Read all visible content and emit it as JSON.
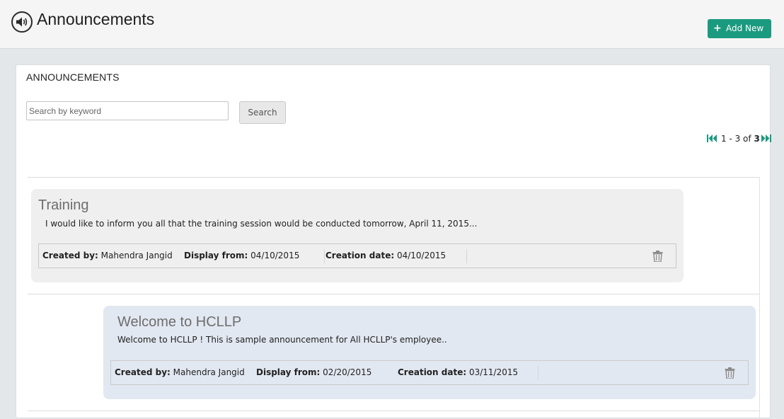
{
  "header": {
    "title": "Announcements",
    "add_button_label": "Add New"
  },
  "panel": {
    "title": "ANNOUNCEMENTS",
    "search": {
      "placeholder": "Search by keyword",
      "value": "",
      "button_label": "Search"
    },
    "pagination": {
      "range": "1 - 3 of",
      "total": "3"
    }
  },
  "announcements": [
    {
      "title": "Training",
      "body": "I would like to inform you all that the training session would be conducted tomorrow, April 11, 2015...",
      "created_by_label": "Created by:",
      "created_by": "Mahendra Jangid",
      "display_from_label": "Display from:",
      "display_from": "04/10/2015",
      "creation_date_label": "Creation date:",
      "creation_date": "04/10/2015"
    },
    {
      "title": "Welcome to HCLLP",
      "body": "Welcome to HCLLP ! This is sample announcement for All HCLLP's employee..",
      "created_by_label": "Created by:",
      "created_by": "Mahendra Jangid",
      "display_from_label": "Display from:",
      "display_from": "02/20/2015",
      "creation_date_label": "Creation date:",
      "creation_date": "03/11/2015"
    }
  ],
  "colors": {
    "accent": "#1a9a7e",
    "card_1_bg": "#efefef",
    "card_2_bg": "#e2e8f1"
  },
  "icons": [
    "speaker-icon",
    "plus-icon",
    "first-page-icon",
    "last-page-icon",
    "trash-icon"
  ]
}
